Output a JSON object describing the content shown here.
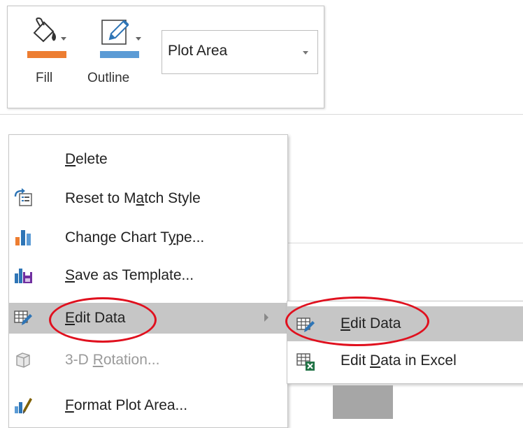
{
  "mini_toolbar": {
    "fill_label": "Fill",
    "outline_label": "Outline",
    "chart_element_selector": {
      "value": "Plot Area"
    }
  },
  "context_menu": {
    "items": [
      {
        "label_pre": "",
        "mnemonic": "D",
        "label_post": "elete",
        "icon": "none",
        "disabled": false
      },
      {
        "label_pre": "Reset to M",
        "mnemonic": "a",
        "label_post": "tch Style",
        "icon": "reset-style-icon",
        "disabled": false
      },
      {
        "label_pre": "Change Chart T",
        "mnemonic": "y",
        "label_post": "pe...",
        "icon": "bar-chart-icon",
        "disabled": false
      },
      {
        "label_pre": "",
        "mnemonic": "S",
        "label_post": "ave as Template...",
        "icon": "save-template-icon",
        "disabled": false
      },
      {
        "label_pre": "",
        "mnemonic": "E",
        "label_post": "dit Data",
        "icon": "edit-data-icon",
        "disabled": false,
        "highlighted": true,
        "has_submenu": true
      },
      {
        "label_pre": "3-D ",
        "mnemonic": "R",
        "label_post": "otation...",
        "icon": "3d-rotation-icon",
        "disabled": true
      },
      {
        "label_pre": "",
        "mnemonic": "F",
        "label_post": "ormat Plot Area...",
        "icon": "format-plot-area-icon",
        "disabled": false
      }
    ]
  },
  "submenu": {
    "items": [
      {
        "label_pre": "",
        "mnemonic": "E",
        "label_post": "dit Data",
        "icon": "edit-data-icon",
        "highlighted": true
      },
      {
        "label_pre": "Edit ",
        "mnemonic": "D",
        "label_post": "ata in Excel",
        "icon": "excel-data-icon",
        "highlighted": false
      }
    ]
  },
  "colors": {
    "fill_swatch": "#ed7d31",
    "outline_swatch": "#5b9bd5",
    "highlight": "#c6c6c6",
    "annotation_red": "#e0101e"
  }
}
